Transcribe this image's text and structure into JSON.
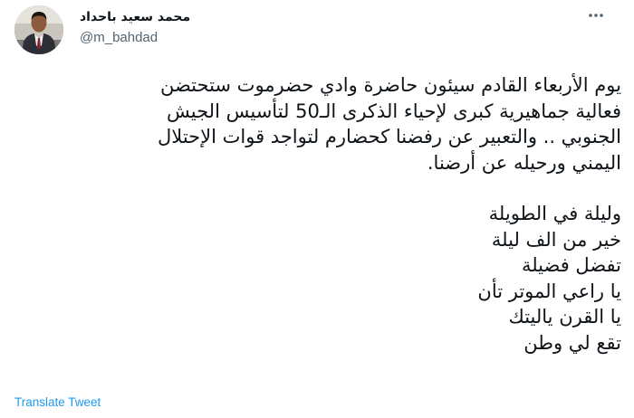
{
  "tweet": {
    "author": {
      "display_name": "محمد سعيد باحداد",
      "handle": "@m_bahdad",
      "avatar_icon": "user-avatar-photo"
    },
    "more_icon": "more-horizontal-icon",
    "paragraph1": [
      "يوم الأربعاء القادم سيئون حاضرة وادي حضرموت ستحتضن",
      "فعالية جماهيرية كبرى لإحياء الذكرى الـ50 لتأسيس الجيش",
      "الجنوبي .. والتعبير عن رفضنا كحضارم لتواجد قوات الإحتلال",
      "اليمني ورحيله عن أرضنا."
    ],
    "paragraph2": [
      "وليلة في الطويلة",
      "خير من الف ليلة",
      "تفضل فضيلة",
      "يا راعي الموتر تأن",
      "يا القرن ياليتك",
      "تقع لي وطن"
    ],
    "translate_label": "Translate Tweet",
    "colors": {
      "text": "#0f1419",
      "secondary": "#536471",
      "link": "#1d9bf0"
    }
  }
}
